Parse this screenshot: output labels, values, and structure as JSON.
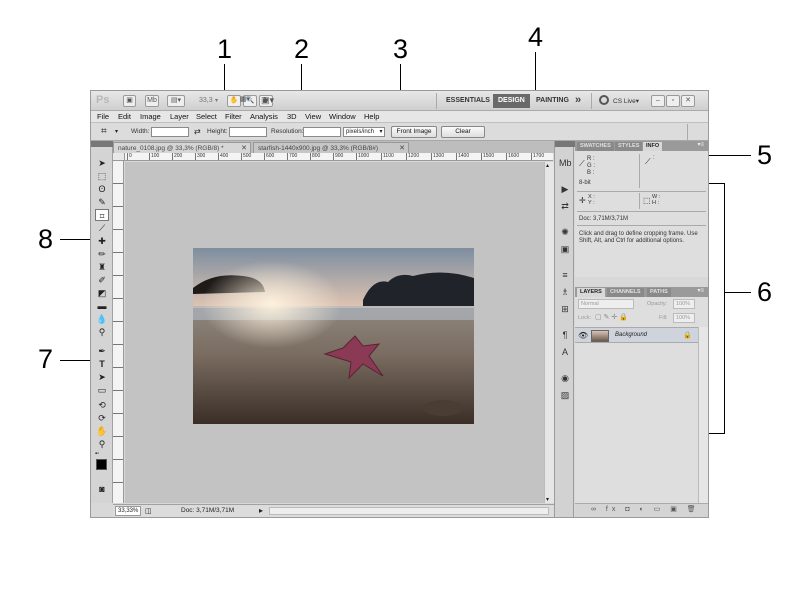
{
  "callouts": [
    "1",
    "2",
    "3",
    "4",
    "5",
    "6",
    "7",
    "8"
  ],
  "appbar": {
    "logo": "Ps",
    "zoom_value": "33,3",
    "workspaces": [
      "ESSENTIALS",
      "DESIGN",
      "PAINTING"
    ],
    "more": "»",
    "cslive": "CS Live▾"
  },
  "menubar": [
    "File",
    "Edit",
    "Image",
    "Layer",
    "Select",
    "Filter",
    "Analysis",
    "3D",
    "View",
    "Window",
    "Help"
  ],
  "options": {
    "width_label": "Width:",
    "height_label": "Height:",
    "resolution_label": "Resolution:",
    "units": "pixels/inch",
    "front_image": "Front Image",
    "clear": "Clear"
  },
  "tabs": [
    {
      "label": "nature_0108.jpg @ 33,3% (RGB/8) *"
    },
    {
      "label": "starfish-1440x900.jpg @ 33,3% (RGB/8#)"
    }
  ],
  "ruler_ticks": [
    "0",
    "100",
    "200",
    "300",
    "400",
    "500",
    "600",
    "700",
    "800",
    "900",
    "1000",
    "1100",
    "1200",
    "1300",
    "1400",
    "1500",
    "1600",
    "1700"
  ],
  "status": {
    "zoom": "33,33%",
    "doc": "Doc: 3,71M/3,71M"
  },
  "info_panel": {
    "tabs": [
      "SWATCHES",
      "STYLES",
      "INFO"
    ],
    "rgb": "R :\nG :\nB :",
    "bit": "8-bit",
    "xy": "X :\nY :",
    "wh": "W :\nH :",
    "doc": "Doc: 3,71M/3,71M",
    "hint": "Click and drag to define cropping frame. Use Shift, Alt, and Ctrl for additional options."
  },
  "layers_panel": {
    "tabs": [
      "LAYERS",
      "CHANNELS",
      "PATHS"
    ],
    "blend_mode": "Normal",
    "opacity_label": "Opacity:",
    "opacity_value": "100%",
    "lock_label": "Lock:",
    "fill_label": "Fill:",
    "fill_value": "100%",
    "layer_name": "Background"
  },
  "colors": {
    "accent": "#6a6a6a",
    "panel": "#d8d8d8",
    "canvas": "#c3c3c3"
  }
}
